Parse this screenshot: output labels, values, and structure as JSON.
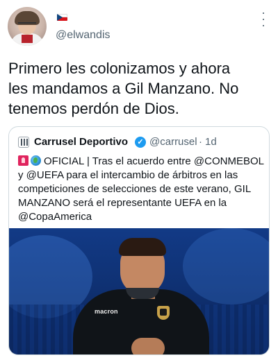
{
  "tweet": {
    "author_flag": "czech-flag",
    "handle": "@elwandis",
    "text": "Primero les colonizamos y ahora\nles mandamos a Gil Manzano. No\ntenemos perdón de Dios."
  },
  "quote": {
    "name": "Carrusel Deportivo",
    "verified": true,
    "handle": "@carrusel",
    "separator": "·",
    "time": "1d",
    "text_after_emoji": "OFICIAL | Tras el acuerdo entre @CONMEBOL y @UEFA para el intercambio de árbitros en las competiciones de selecciones de este verano, GIL MANZANO será el representante UEFA en la @CopaAmerica",
    "emojis": [
      "rotating-light-icon",
      "globe-icon"
    ],
    "photo": {
      "shirt_brand": "macron"
    }
  },
  "colors": {
    "text": "#0f1419",
    "secondary": "#536471",
    "verified": "#1d9bf0",
    "border": "#cfd9de"
  }
}
